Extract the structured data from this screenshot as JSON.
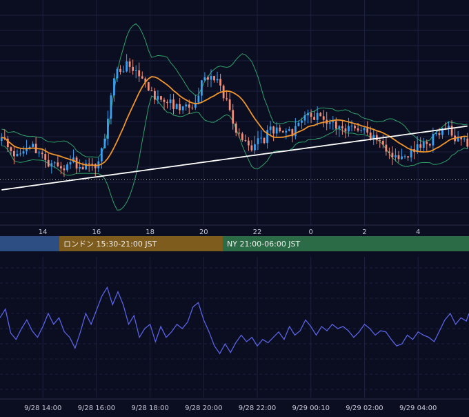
{
  "theme": {
    "background": "#0b0d20",
    "grid": "#1c2140",
    "up_candle": "#3aa0f0",
    "down_candle": "#ef8f7a",
    "bollinger": "#2fa36b",
    "ema": "#f0962c",
    "sma_long": "#ffffff",
    "oscillator": "#5a63e6",
    "tick_text": "#c8cad8"
  },
  "sessions": [
    {
      "label": "",
      "color": "#2c4e82"
    },
    {
      "label": "ロンドン 15:30-21:00 JST",
      "color": "#7e5c1e"
    },
    {
      "label": "NY 21:00-06:00 JST",
      "color": "#2b6b45"
    }
  ],
  "chart_data": [
    {
      "type": "candlestick",
      "title": "",
      "x_ticks": [
        "14",
        "16",
        "18",
        "20",
        "22",
        "0",
        "2",
        "4"
      ],
      "x_range_hours": [
        12.4,
        29.9
      ],
      "y_axis_labels_visible": false,
      "grid": true,
      "overlays": [
        "Bollinger Bands",
        "moving average (orange)",
        "moving average (white)",
        "horizontal dotted price line"
      ]
    },
    {
      "type": "line",
      "title": "",
      "x_ticks": [
        "9/28 14:00",
        "9/28 16:00",
        "9/28 18:00",
        "9/28 20:00",
        "9/28 22:00",
        "9/29 00:10",
        "9/29 02:00",
        "9/29 04:00"
      ],
      "x_range_hours": [
        12.4,
        29.9
      ],
      "y_axis_labels_visible": false,
      "grid": true,
      "points": [
        [
          12.4,
          0.68
        ],
        [
          12.6,
          0.76
        ],
        [
          12.8,
          0.54
        ],
        [
          13.0,
          0.48
        ],
        [
          13.2,
          0.58
        ],
        [
          13.4,
          0.66
        ],
        [
          13.6,
          0.56
        ],
        [
          13.8,
          0.5
        ],
        [
          14.0,
          0.6
        ],
        [
          14.2,
          0.72
        ],
        [
          14.4,
          0.62
        ],
        [
          14.6,
          0.68
        ],
        [
          14.8,
          0.55
        ],
        [
          15.0,
          0.5
        ],
        [
          15.2,
          0.4
        ],
        [
          15.4,
          0.55
        ],
        [
          15.6,
          0.72
        ],
        [
          15.8,
          0.62
        ],
        [
          16.0,
          0.75
        ],
        [
          16.2,
          0.88
        ],
        [
          16.4,
          0.96
        ],
        [
          16.6,
          0.8
        ],
        [
          16.8,
          0.92
        ],
        [
          17.0,
          0.8
        ],
        [
          17.2,
          0.62
        ],
        [
          17.4,
          0.7
        ],
        [
          17.6,
          0.5
        ],
        [
          17.8,
          0.58
        ],
        [
          18.0,
          0.62
        ],
        [
          18.2,
          0.46
        ],
        [
          18.4,
          0.6
        ],
        [
          18.6,
          0.5
        ],
        [
          18.8,
          0.55
        ],
        [
          19.0,
          0.62
        ],
        [
          19.2,
          0.58
        ],
        [
          19.4,
          0.64
        ],
        [
          19.6,
          0.78
        ],
        [
          19.8,
          0.82
        ],
        [
          20.0,
          0.66
        ],
        [
          20.2,
          0.55
        ],
        [
          20.4,
          0.42
        ],
        [
          20.6,
          0.35
        ],
        [
          20.8,
          0.44
        ],
        [
          21.0,
          0.36
        ],
        [
          21.2,
          0.45
        ],
        [
          21.4,
          0.52
        ],
        [
          21.6,
          0.46
        ],
        [
          21.8,
          0.5
        ],
        [
          22.0,
          0.42
        ],
        [
          22.2,
          0.48
        ],
        [
          22.4,
          0.45
        ],
        [
          22.6,
          0.5
        ],
        [
          22.8,
          0.55
        ],
        [
          23.0,
          0.48
        ],
        [
          23.2,
          0.6
        ],
        [
          23.4,
          0.52
        ],
        [
          23.6,
          0.56
        ],
        [
          23.8,
          0.66
        ],
        [
          24.0,
          0.6
        ],
        [
          24.2,
          0.52
        ],
        [
          24.4,
          0.6
        ],
        [
          24.6,
          0.56
        ],
        [
          24.8,
          0.62
        ],
        [
          25.0,
          0.58
        ],
        [
          25.2,
          0.6
        ],
        [
          25.4,
          0.56
        ],
        [
          25.6,
          0.5
        ],
        [
          25.8,
          0.55
        ],
        [
          26.0,
          0.62
        ],
        [
          26.2,
          0.58
        ],
        [
          26.4,
          0.52
        ],
        [
          26.6,
          0.56
        ],
        [
          26.8,
          0.55
        ],
        [
          27.0,
          0.48
        ],
        [
          27.2,
          0.42
        ],
        [
          27.4,
          0.44
        ],
        [
          27.6,
          0.52
        ],
        [
          27.8,
          0.48
        ],
        [
          28.0,
          0.55
        ],
        [
          28.2,
          0.52
        ],
        [
          28.4,
          0.5
        ],
        [
          28.6,
          0.46
        ],
        [
          28.8,
          0.56
        ],
        [
          29.0,
          0.66
        ],
        [
          29.2,
          0.72
        ],
        [
          29.4,
          0.62
        ],
        [
          29.6,
          0.68
        ],
        [
          29.8,
          0.65
        ],
        [
          29.9,
          0.72
        ]
      ]
    }
  ]
}
